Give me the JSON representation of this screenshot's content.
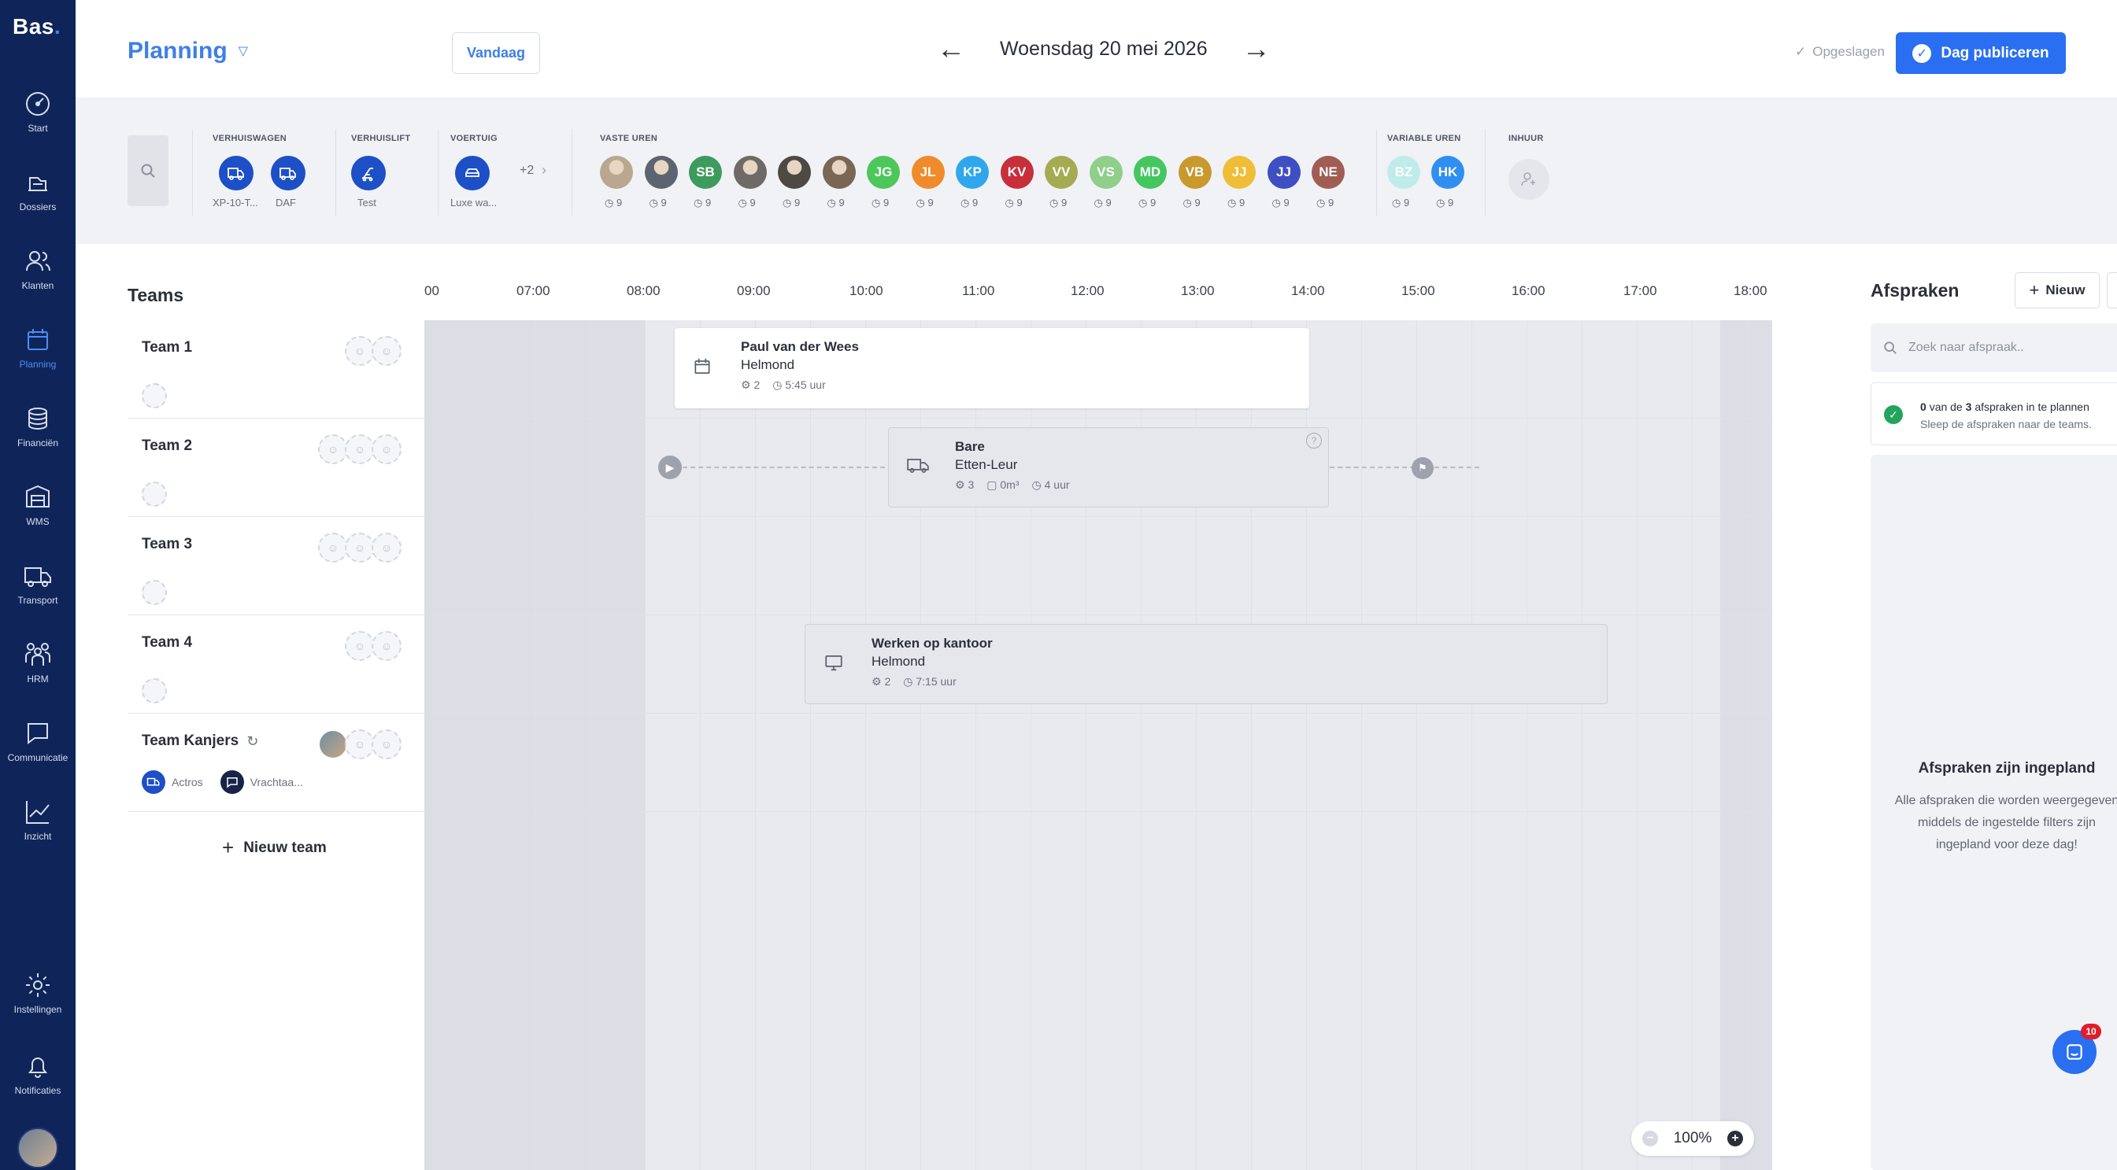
{
  "sidebar": {
    "logo": "Bas",
    "logo_dot": ".",
    "items": [
      {
        "label": "Start",
        "icon": "dashboard-icon"
      },
      {
        "label": "Dossiers",
        "icon": "dossiers-icon"
      },
      {
        "label": "Klanten",
        "icon": "customers-icon"
      },
      {
        "label": "Planning",
        "icon": "calendar-icon",
        "active": true
      },
      {
        "label": "Financiën",
        "icon": "coins-icon"
      },
      {
        "label": "WMS",
        "icon": "warehouse-icon"
      },
      {
        "label": "Transport",
        "icon": "truck-icon"
      },
      {
        "label": "HRM",
        "icon": "people-icon"
      },
      {
        "label": "Communicatie",
        "icon": "chat-icon"
      },
      {
        "label": "Inzicht",
        "icon": "chart-icon"
      },
      {
        "label": "Instellingen",
        "icon": "gear-icon"
      },
      {
        "label": "Notificaties",
        "icon": "bell-icon"
      }
    ]
  },
  "header": {
    "title": "Planning",
    "today_button": "Vandaag",
    "date": "Woensdag 20 mei 2026",
    "saved_status": "Opgeslagen",
    "publish_button": "Dag publiceren"
  },
  "resources": {
    "groups": [
      {
        "name": "VERHUISWAGEN",
        "items": [
          "XP-10-T...",
          "DAF"
        ]
      },
      {
        "name": "VERHUISLIFT",
        "items": [
          "Test"
        ]
      },
      {
        "name": "VOERTUIG",
        "items": [
          "Luxe wa..."
        ],
        "more": "+2"
      },
      {
        "name": "VASTE UREN"
      },
      {
        "name": "VARIABLE UREN"
      },
      {
        "name": "INHUUR"
      }
    ],
    "fixed_staff": [
      {
        "initials": "",
        "color": "#b9a88f",
        "hours": "9",
        "photo": true
      },
      {
        "initials": "",
        "color": "#5b6470",
        "hours": "9",
        "photo": true
      },
      {
        "initials": "SB",
        "color": "#3e9b5e",
        "hours": "9"
      },
      {
        "initials": "",
        "color": "#6e6a66",
        "hours": "9",
        "photo": true
      },
      {
        "initials": "",
        "color": "#4d4a44",
        "hours": "9",
        "photo": true
      },
      {
        "initials": "",
        "color": "#7a6655",
        "hours": "9",
        "photo": true
      },
      {
        "initials": "JG",
        "color": "#4cc75a",
        "hours": "9"
      },
      {
        "initials": "JL",
        "color": "#f08b2c",
        "hours": "9"
      },
      {
        "initials": "KP",
        "color": "#2fa7ec",
        "hours": "9"
      },
      {
        "initials": "KV",
        "color": "#c72f3b",
        "hours": "9"
      },
      {
        "initials": "VV",
        "color": "#a5ab52",
        "hours": "9"
      },
      {
        "initials": "VS",
        "color": "#8fcf89",
        "hours": "9"
      },
      {
        "initials": "MD",
        "color": "#45c760",
        "hours": "9"
      },
      {
        "initials": "VB",
        "color": "#c9992d",
        "hours": "9"
      },
      {
        "initials": "JJ",
        "color": "#efbe36",
        "hours": "9"
      },
      {
        "initials": "JJ",
        "color": "#3d4fc2",
        "hours": "9"
      },
      {
        "initials": "NE",
        "color": "#a15d53",
        "hours": "9"
      }
    ],
    "variable_staff": [
      {
        "initials": "BZ",
        "color": "#bfece8",
        "hours": "9"
      },
      {
        "initials": "HK",
        "color": "#2f8ff0",
        "hours": "9"
      }
    ]
  },
  "teams": {
    "title": "Teams",
    "items": [
      {
        "name": "Team 1",
        "slots": 2
      },
      {
        "name": "Team 2",
        "slots": 3
      },
      {
        "name": "Team 3",
        "slots": 3
      },
      {
        "name": "Team 4",
        "slots": 2
      },
      {
        "name": "Team Kanjers",
        "slots": 3,
        "vehicles": [
          "Actros",
          "Vrachtaa..."
        ]
      }
    ],
    "new_team": "Nieuw team"
  },
  "timeline": {
    "ticks": [
      "00",
      "07:00",
      "08:00",
      "09:00",
      "10:00",
      "11:00",
      "12:00",
      "13:00",
      "14:00",
      "15:00",
      "16:00",
      "17:00",
      "18:00"
    ],
    "appointments": [
      {
        "title": "Paul van der Wees",
        "location": "Helmond",
        "people": "2",
        "duration": "5:45 uur",
        "icon": "calendar-icon"
      },
      {
        "title": "Bare",
        "location": "Etten-Leur",
        "people": "3",
        "volume": "0m³",
        "duration": "4 uur",
        "icon": "truck-icon"
      },
      {
        "title": "Werken op kantoor",
        "location": "Helmond",
        "people": "2",
        "duration": "7:15 uur",
        "icon": "desktop-icon"
      }
    ]
  },
  "appointments_panel": {
    "title": "Afspraken",
    "new_button": "Nieuw",
    "search_placeholder": "Zoek naar afspraak..",
    "status_count": "0",
    "status_total": "3",
    "status_text_a": "van de",
    "status_text_b": "afspraken in te plannen",
    "status_hint": "Sleep de afspraken naar de teams.",
    "empty_title": "Afspraken zijn ingepland",
    "empty_text": "Alle afspraken die worden weergegeven middels de ingestelde filters zijn ingepland voor deze dag!"
  },
  "zoom": {
    "level": "100%"
  },
  "chat": {
    "badge": "10"
  },
  "colors": {
    "sidebar": "#0f2559",
    "accent": "#2a6ef2",
    "success": "#22a45d"
  }
}
